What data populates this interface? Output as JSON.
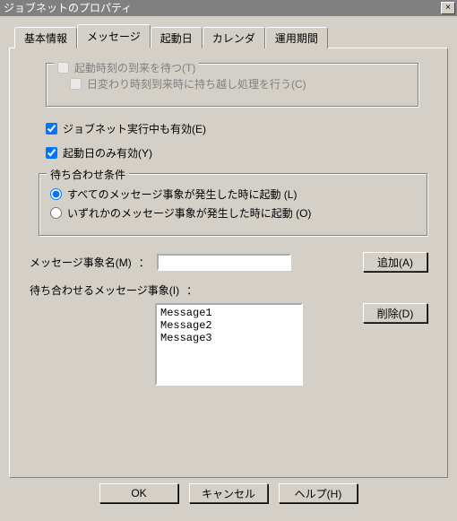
{
  "window": {
    "title": "ジョブネットのプロパティ"
  },
  "tabs": [
    "基本情報",
    "メッセージ",
    "起動日",
    "カレンダ",
    "運用期間"
  ],
  "group_wait_time": {
    "legend": "起動時刻の到来を待つ(T)",
    "carryover": "日変わり時刻到来時に持ち越し処理を行う(C)"
  },
  "checks": {
    "during_exec": "ジョブネット実行中も有効(E)",
    "only_start_day": "起動日のみ有効(Y)"
  },
  "group_condition": {
    "legend": "待ち合わせ条件",
    "opt_all": "すべてのメッセージ事象が発生した時に起動 (L)",
    "opt_any": "いずれかのメッセージ事象が発生した時に起動 (O)"
  },
  "msg_name_label": "メッセージ事象名(M)",
  "colon": "：",
  "add_btn": "追加(A)",
  "wait_list_label": "待ち合わせるメッセージ事象(I)",
  "delete_btn": "削除(D)",
  "messages": [
    "Message1",
    "Message2",
    "Message3"
  ],
  "footer": {
    "ok": "OK",
    "cancel": "キャンセル",
    "help": "ヘルプ(H)"
  }
}
